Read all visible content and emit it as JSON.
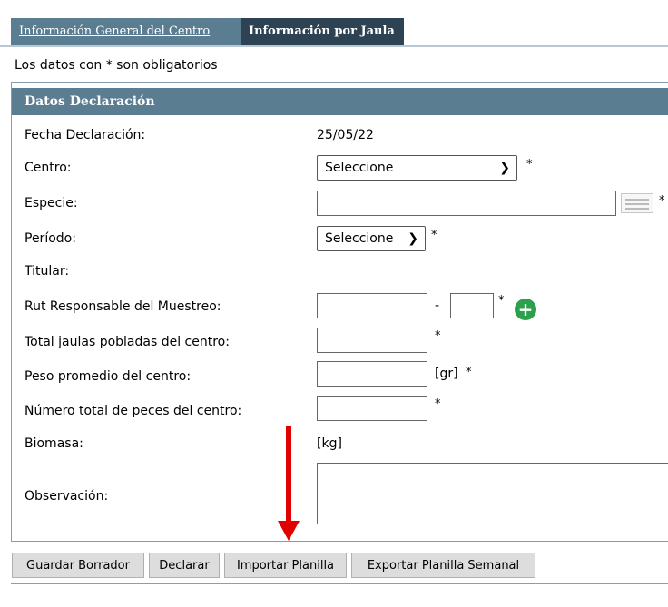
{
  "tabs": [
    {
      "label": "Información General del Centro"
    },
    {
      "label": "Información por Jaula"
    }
  ],
  "required_note": "Los datos con * son obligatorios",
  "section_title": "Datos Declaración",
  "required_mark": "*",
  "form": {
    "fecha": {
      "label": "Fecha Declaración:",
      "value": "25/05/22"
    },
    "centro": {
      "label": "Centro:",
      "selected": "Seleccione"
    },
    "especie": {
      "label": "Especie:"
    },
    "periodo": {
      "label": "Período:",
      "selected": "Seleccione"
    },
    "titular": {
      "label": "Titular:"
    },
    "rut": {
      "label": "Rut Responsable del Muestreo:",
      "separator": "-"
    },
    "jaulas": {
      "label": "Total jaulas pobladas del centro:"
    },
    "peso": {
      "label": "Peso promedio del centro:",
      "unit": "[gr]"
    },
    "peces": {
      "label": "Número total de peces del centro:"
    },
    "biomasa": {
      "label": "Biomasa:",
      "unit": "[kg]"
    },
    "observacion": {
      "label": "Observación:"
    }
  },
  "buttons": {
    "guardar": "Guardar Borrador",
    "declarar": "Declarar",
    "importar": "Importar Planilla",
    "exportar": "Exportar Planilla Semanal"
  },
  "icons": {
    "list": "list-lookup-icon",
    "add": "add-circle-icon",
    "caret": "chevron-down-icon"
  },
  "colors": {
    "tab_active": "#5b7d92",
    "tab_dark": "#2d4253",
    "add_green": "#2aa14a",
    "arrow_red": "#e00000"
  }
}
